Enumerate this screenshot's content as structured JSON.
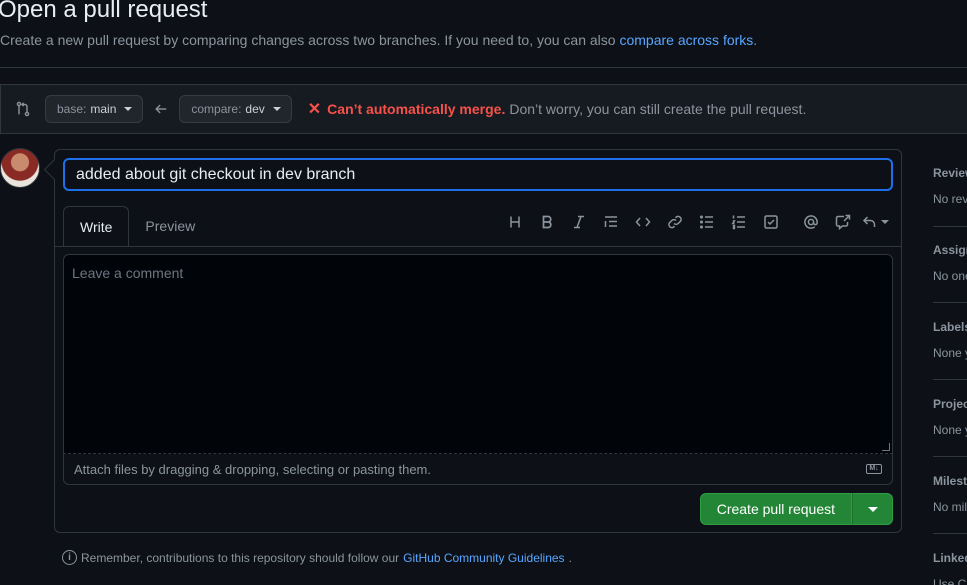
{
  "header": {
    "title": "Open a pull request",
    "subtitle_text": "Create a new pull request by comparing changes across two branches. If you need to, you can also",
    "subtitle_link": "compare across forks",
    "subtitle_end": "."
  },
  "range": {
    "base_prefix": "base:",
    "base_branch": "main",
    "compare_prefix": "compare:",
    "compare_branch": "dev",
    "merge_status_strong": "Can’t automatically merge.",
    "merge_status_msg": "Don’t worry, you can still create the pull request."
  },
  "form": {
    "title_value": "added about git checkout in dev branch",
    "tabs": [
      "Write",
      "Preview"
    ],
    "comment_placeholder": "Leave a comment",
    "attach_text": "Attach files by dragging & dropping, selecting or pasting them.",
    "markdown_badge": "M↓",
    "create_label": "Create pull request"
  },
  "toolbar": {
    "icons": [
      "heading-icon",
      "bold-icon",
      "italic-icon",
      "quote-icon",
      "code-icon",
      "link-icon",
      "unordered-list-icon",
      "ordered-list-icon",
      "task-list-icon",
      "mention-icon",
      "reference-icon",
      "reply-icon"
    ]
  },
  "footer": {
    "guidelines_text": "Remember, contributions to this repository should follow our",
    "guidelines_link": "GitHub Community Guidelines",
    "guidelines_end": "."
  },
  "sidebar": {
    "sections": [
      {
        "heading": "Reviewers",
        "value": "No reviews"
      },
      {
        "heading": "Assignees",
        "value": "No one"
      },
      {
        "heading": "Labels",
        "value": "None yet"
      },
      {
        "heading": "Projects",
        "value": "None yet"
      },
      {
        "heading": "Milestone",
        "value": "No milestone"
      },
      {
        "heading": "Linked",
        "value": "Use Closing keywords"
      }
    ]
  },
  "colors": {
    "background": "#0d1117",
    "accent_link": "#58a6ff",
    "merge_error": "#f85149",
    "create_button": "#238636",
    "focus_border": "#1f6feb"
  }
}
